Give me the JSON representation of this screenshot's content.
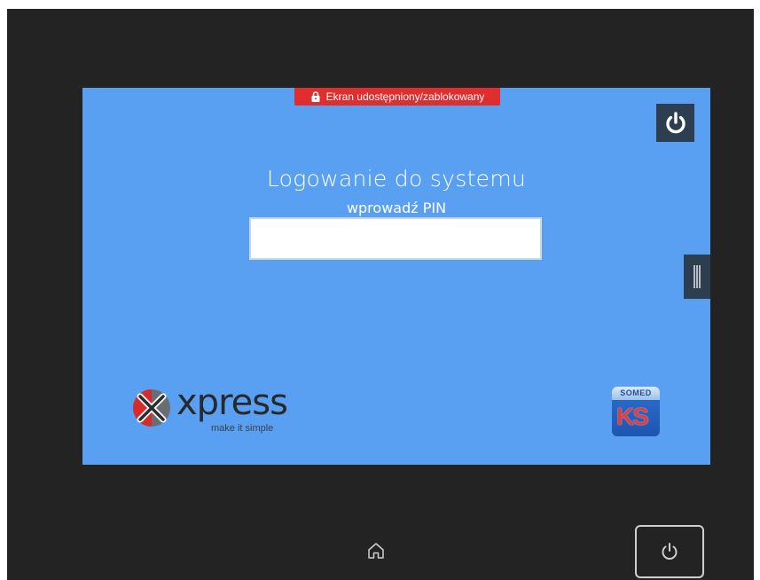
{
  "banner": {
    "text": "Ekran udostępniony/zablokowany",
    "icon": "lock-icon",
    "color": "#e02d2d"
  },
  "login": {
    "title": "Logowanie do systemu",
    "subtitle": "wprowadź PIN",
    "pin_value": ""
  },
  "logos": {
    "xpress_brand": "xpress",
    "xpress_tagline": "make it simple",
    "somed_top": "SOMED",
    "somed_ks": "KS"
  },
  "icons": {
    "power_top": "power-icon",
    "side_handle": "handle-bars-icon",
    "home": "home-icon",
    "power_hardware": "power-icon"
  },
  "colors": {
    "screen_bg": "#5aa0f2",
    "panel_dark": "#2d3e50",
    "bezel": "#232323"
  }
}
